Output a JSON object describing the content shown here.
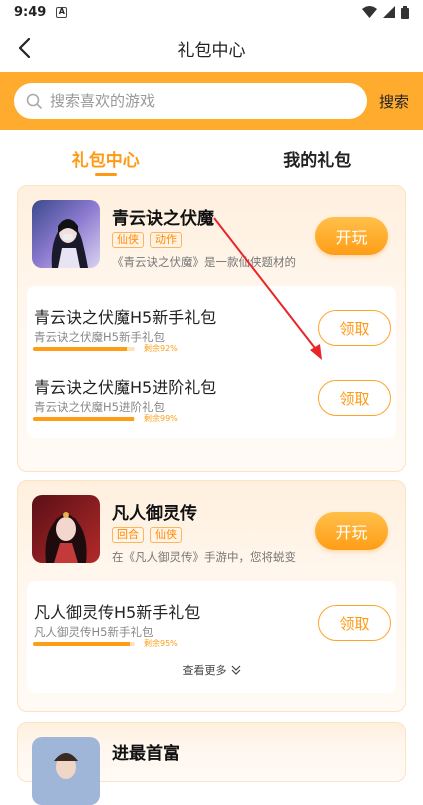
{
  "status": {
    "time": "9:49",
    "notif": "A"
  },
  "nav": {
    "title": "礼包中心"
  },
  "search": {
    "placeholder": "搜索喜欢的游戏",
    "button": "搜索"
  },
  "tabs": [
    {
      "label": "礼包中心"
    },
    {
      "label": "我的礼包"
    }
  ],
  "cards": [
    {
      "name": "青云诀之伏魔",
      "tags": [
        "仙侠",
        "动作"
      ],
      "desc": "《青云诀之伏魔》是一款仙侠题材的",
      "play": "开玩",
      "gifts": [
        {
          "title": "青云诀之伏魔H5新手礼包",
          "sub": "青云诀之伏魔H5新手礼包",
          "remain": "剩余92%",
          "pct": 92,
          "claim": "领取"
        },
        {
          "title": "青云诀之伏魔H5进阶礼包",
          "sub": "青云诀之伏魔H5进阶礼包",
          "remain": "剩余99%",
          "pct": 99,
          "claim": "领取"
        }
      ]
    },
    {
      "name": "凡人御灵传",
      "tags": [
        "回合",
        "仙侠"
      ],
      "desc": "在《凡人御灵传》手游中，您将蜕变",
      "play": "开玩",
      "gifts": [
        {
          "title": "凡人御灵传H5新手礼包",
          "sub": "凡人御灵传H5新手礼包",
          "remain": "剩余95%",
          "pct": 95,
          "claim": "领取"
        }
      ],
      "more": "查看更多"
    },
    {
      "name": "进最首富"
    }
  ],
  "colors": {
    "accent": "#ff9d16",
    "searchbar": "#ffac2e"
  }
}
